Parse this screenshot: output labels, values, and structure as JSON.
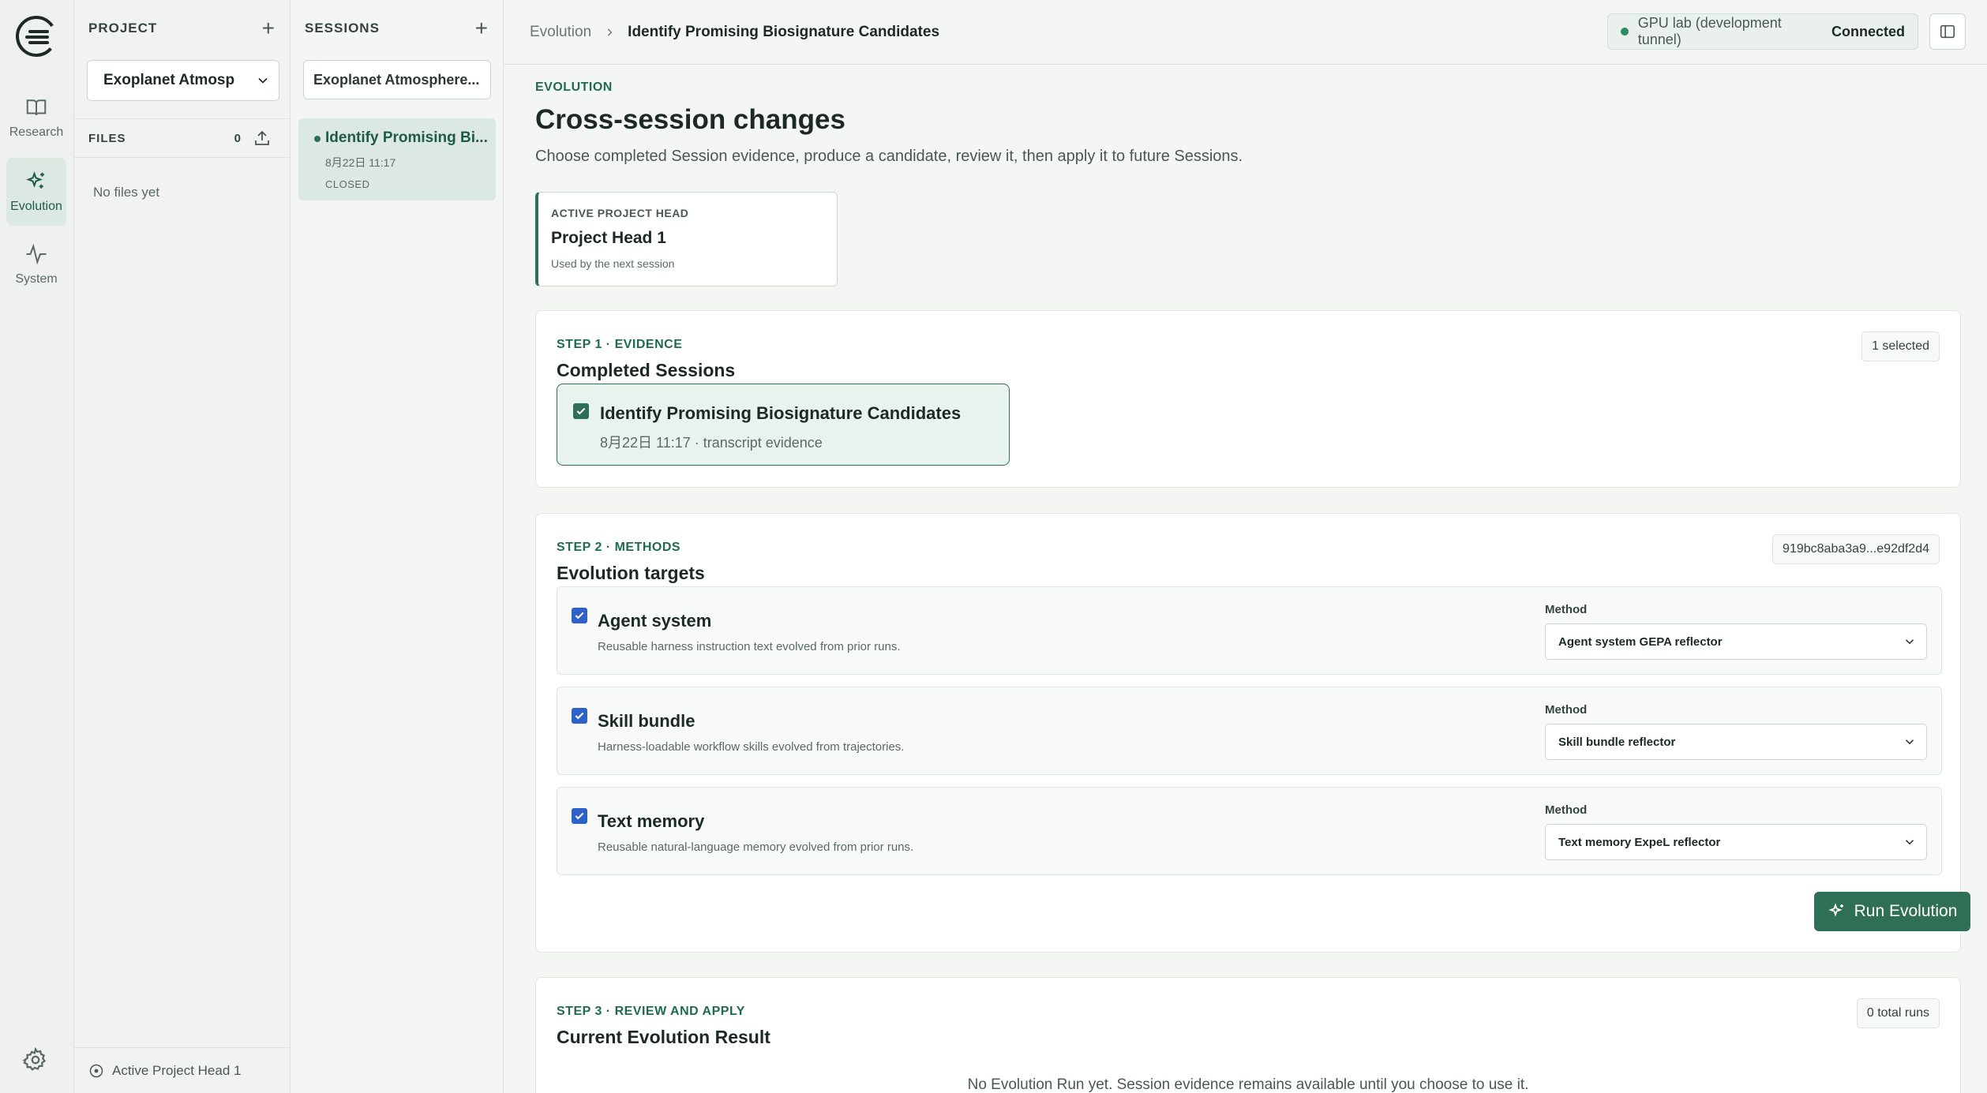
{
  "rail": {
    "items": [
      {
        "label": "Research",
        "icon": "book-icon"
      },
      {
        "label": "Evolution",
        "icon": "sparkle-icon"
      },
      {
        "label": "System",
        "icon": "pulse-icon"
      }
    ]
  },
  "project": {
    "heading": "PROJECT",
    "selected": "Exoplanet Atmosp",
    "files_heading": "FILES",
    "files_count": "0",
    "empty": "No files yet",
    "active_head": "Active Project Head 1"
  },
  "sessions": {
    "heading": "SESSIONS",
    "filter": "Exoplanet Atmosphere...",
    "items": [
      {
        "title": "Identify Promising Bi...",
        "date": "8月22日 11:17",
        "status": "CLOSED"
      }
    ]
  },
  "topbar": {
    "crumb_root": "Evolution",
    "crumb_current": "Identify Promising Biosignature Candidates",
    "status_name": "GPU lab (development tunnel)",
    "status_value": "Connected"
  },
  "page": {
    "eyebrow": "EVOLUTION",
    "title": "Cross-session changes",
    "subtitle": "Choose completed Session evidence, produce a candidate, review it, then apply it to future Sessions."
  },
  "head_card": {
    "label": "ACTIVE PROJECT HEAD",
    "value": "Project Head 1",
    "note": "Used by the next session"
  },
  "step1": {
    "eyebrow": "STEP 1 · EVIDENCE",
    "title": "Completed Sessions",
    "badge": "1 selected",
    "evidence": {
      "title": "Identify Promising Biosignature Candidates",
      "meta": "8月22日 11:17 · transcript evidence"
    }
  },
  "step2": {
    "eyebrow": "STEP 2 · METHODS",
    "title": "Evolution targets",
    "badge": "919bc8aba3a9...e92df2d4",
    "method_label": "Method",
    "targets": [
      {
        "name": "Agent system",
        "desc": "Reusable harness instruction text evolved from prior runs.",
        "method": "Agent system GEPA reflector"
      },
      {
        "name": "Skill bundle",
        "desc": "Harness-loadable workflow skills evolved from trajectories.",
        "method": "Skill bundle reflector"
      },
      {
        "name": "Text memory",
        "desc": "Reusable natural-language memory evolved from prior runs.",
        "method": "Text memory ExpeL reflector"
      }
    ],
    "run_label": "Run Evolution"
  },
  "step3": {
    "eyebrow": "STEP 3 · REVIEW AND APPLY",
    "title": "Current Evolution Result",
    "badge": "0 total runs",
    "empty": "No Evolution Run yet. Session evidence remains available until you choose to use it."
  },
  "colors": {
    "accent": "#2f6f55",
    "checkbox": "#2f62c9",
    "status_dot": "#2f8a5f"
  }
}
